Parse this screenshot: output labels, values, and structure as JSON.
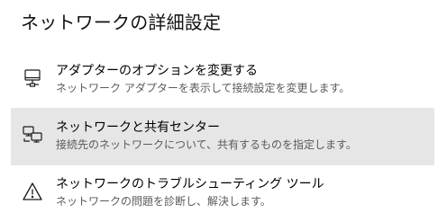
{
  "page": {
    "title": "ネットワークの詳細設定"
  },
  "items": [
    {
      "title": "アダプターのオプションを変更する",
      "description": "ネットワーク アダプターを表示して接続設定を変更します。",
      "icon": "network-adapter-icon"
    },
    {
      "title": "ネットワークと共有センター",
      "description": "接続先のネットワークについて、共有するものを指定します。",
      "icon": "sharing-center-icon",
      "hovered": true
    },
    {
      "title": "ネットワークのトラブルシューティング ツール",
      "description": "ネットワークの問題を診断し、解決します。",
      "icon": "warning-icon"
    }
  ],
  "colors": {
    "hover_background": "#e6e6e6",
    "title_text": "#000000",
    "description_text": "#5a5a5a"
  }
}
